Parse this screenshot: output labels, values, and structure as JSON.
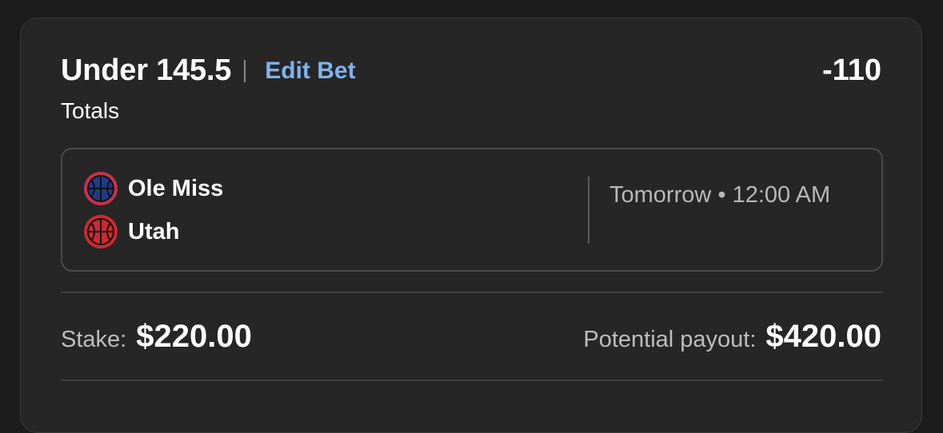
{
  "bet": {
    "selection": "Under 145.5",
    "edit_label": "Edit Bet",
    "odds": "-110",
    "market": "Totals"
  },
  "event": {
    "teams": [
      {
        "name": "Ole Miss",
        "icon": "basketball-icon",
        "color": "#1e3a8a",
        "ring": "#c8324a"
      },
      {
        "name": "Utah",
        "icon": "basketball-icon",
        "color": "#cc2a2f",
        "ring": "#cc2a2f"
      }
    ],
    "time": "Tomorrow • 12:00 AM"
  },
  "footer": {
    "stake_label": "Stake:",
    "stake_value": "$220.00",
    "payout_label": "Potential payout:",
    "payout_value": "$420.00"
  },
  "colors": {
    "background": "#1c1c1c",
    "card": "#262626",
    "accent_link": "#7fb3ec"
  }
}
